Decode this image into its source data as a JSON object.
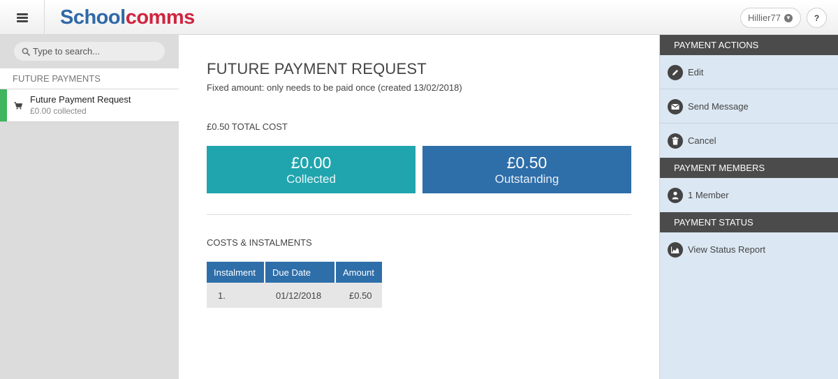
{
  "header": {
    "logo_part1": "Scho",
    "logo_part2": "ol",
    "logo_part3": "comms",
    "user_name": "Hillier77",
    "help_label": "?"
  },
  "sidebar": {
    "search_placeholder": "Type to search...",
    "section_title": "FUTURE PAYMENTS",
    "items": [
      {
        "title": "Future Payment Request",
        "subtitle": "£0.00 collected",
        "icon": "cart-icon"
      }
    ]
  },
  "main": {
    "title": "FUTURE PAYMENT REQUEST",
    "subtitle": "Fixed amount: only needs to be paid once (created 13/02/2018)",
    "total_cost": "£0.50 TOTAL COST",
    "collected": {
      "amount": "£0.00",
      "label": "Collected"
    },
    "outstanding": {
      "amount": "£0.50",
      "label": "Outstanding"
    },
    "costs_title": "COSTS & INSTALMENTS",
    "table": {
      "headers": [
        "Instalment",
        "Due Date",
        "Amount"
      ],
      "rows": [
        [
          "1.",
          "01/12/2018",
          "£0.50"
        ]
      ]
    }
  },
  "right_panel": {
    "payment_actions_title": "PAYMENT ACTIONS",
    "actions": [
      {
        "label": "Edit",
        "icon": "pencil-icon"
      },
      {
        "label": "Send Message",
        "icon": "envelope-icon"
      },
      {
        "label": "Cancel",
        "icon": "trash-icon"
      }
    ],
    "payment_members_title": "PAYMENT MEMBERS",
    "members_label": "1 Member",
    "payment_status_title": "PAYMENT STATUS",
    "status_report_label": "View Status Report"
  },
  "colors": {
    "logo_blue": "#2f69a8",
    "logo_red": "#d0243f",
    "collected_tile": "#20a5ae",
    "outstanding_tile": "#2e6ea9",
    "sidebar_accent": "#3fb55e",
    "panel_header": "#4b4b4b",
    "panel_bg": "#dbe7f2"
  }
}
